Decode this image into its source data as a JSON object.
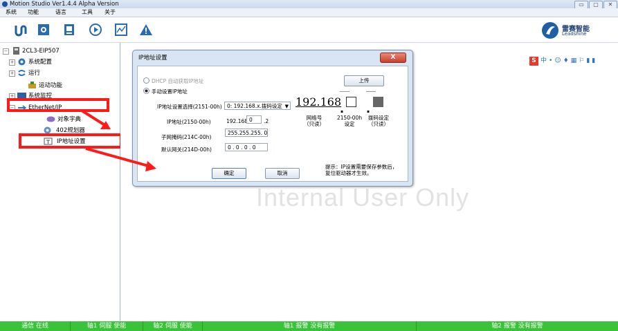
{
  "window": {
    "title": "Motion Studio  Ver1.4.4 Alpha Version"
  },
  "menubar": [
    "系统",
    "功能",
    "语言",
    "工具",
    "关于"
  ],
  "toolbar": {
    "icons": [
      "motor-icon",
      "config-icon",
      "document-icon",
      "play-icon",
      "chart-icon",
      "warning-icon"
    ]
  },
  "logo": {
    "cn": "雷赛智能",
    "en": "Leadshine"
  },
  "tree": {
    "root": "2CL3-EIP507",
    "items": [
      "系统配置",
      "运行",
      "运动功能",
      "系统监控",
      "EtherNet/IP",
      "对象字典",
      "402规划器",
      "IP地址设置"
    ]
  },
  "watermark": "Internal User Only",
  "dialog": {
    "title": "IP地址设置",
    "close": "X",
    "radio_dhcp": "DHCP 自动获取IP地址",
    "radio_manual": "手动设置IP地址",
    "upload_button": "上传",
    "select_label": "IP地址设置选择(2151-00h)",
    "select_value": "0: 192.168.x.拨码设定",
    "ip_label": "IP地址(2150-00h)",
    "ip_a": "192.168.",
    "ip_b": "0",
    "ip_c": ".2",
    "big_ip": "192.168",
    "network_caption": "网络号\n（只读）",
    "setting_caption": "2150-00h\n设定",
    "dial_caption": "拨码设定\n（只读）",
    "subnet_label": "子网掩码(214C-00h)",
    "subnet_value": "255.255.255. 0",
    "gateway_label": "默认网关(214D-00h)",
    "gateway_value": "0 . 0 . 0 . 0",
    "ok_button": "确定",
    "cancel_button": "取消",
    "hint": "提示：IP设置需要保存参数后，\n复位驱动器才生效。"
  },
  "status": [
    "通信 在线",
    "轴1 伺服 使能",
    "轴2 伺服 使能",
    "轴1 报警 没有报警",
    "轴2 报警 没有报警"
  ],
  "colors": {
    "status_green": "#3ac23a",
    "annotation_red": "#ff1a1a"
  }
}
